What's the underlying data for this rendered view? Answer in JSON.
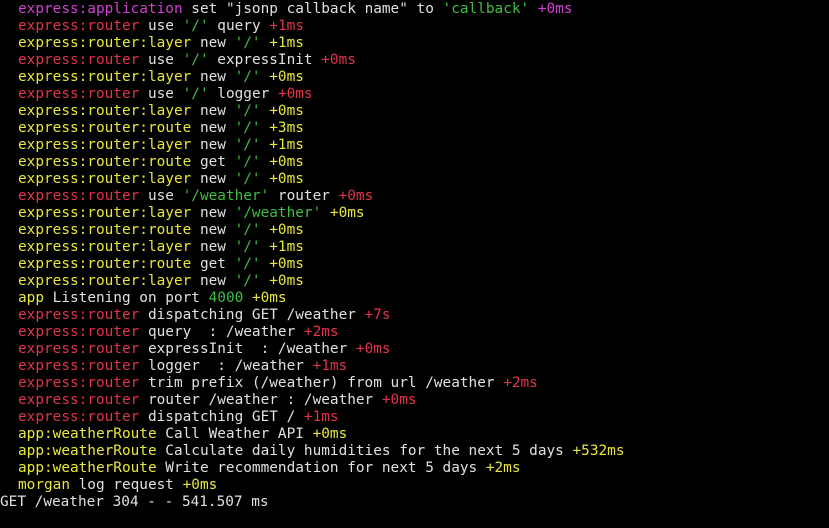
{
  "colors": {
    "magenta": "#d23fd2",
    "red": "#e0344a",
    "yellow": "#e8e83a",
    "green": "#3fbf3f",
    "white": "#e0e0e0"
  },
  "terminal": {
    "lines": [
      {
        "ns": "express:application",
        "ns_color": "#d23fd2",
        "segments": [
          {
            "t": " set \"jsonp callback name\" to ",
            "c": "#e0e0e0"
          },
          {
            "t": "'callback'",
            "c": "#3fbf3f"
          },
          {
            "t": " +0ms",
            "c": "#d23fd2"
          }
        ]
      },
      {
        "ns": "express:router",
        "ns_color": "#e0344a",
        "segments": [
          {
            "t": " use ",
            "c": "#e0e0e0"
          },
          {
            "t": "'/'",
            "c": "#3fbf3f"
          },
          {
            "t": " query ",
            "c": "#e0e0e0"
          },
          {
            "t": "+1ms",
            "c": "#e0344a"
          }
        ]
      },
      {
        "ns": "express:router:layer",
        "ns_color": "#e8e83a",
        "segments": [
          {
            "t": " new ",
            "c": "#e0e0e0"
          },
          {
            "t": "'/'",
            "c": "#3fbf3f"
          },
          {
            "t": " +1ms",
            "c": "#e8e83a"
          }
        ]
      },
      {
        "ns": "express:router",
        "ns_color": "#e0344a",
        "segments": [
          {
            "t": " use ",
            "c": "#e0e0e0"
          },
          {
            "t": "'/'",
            "c": "#3fbf3f"
          },
          {
            "t": " expressInit ",
            "c": "#e0e0e0"
          },
          {
            "t": "+0ms",
            "c": "#e0344a"
          }
        ]
      },
      {
        "ns": "express:router:layer",
        "ns_color": "#e8e83a",
        "segments": [
          {
            "t": " new ",
            "c": "#e0e0e0"
          },
          {
            "t": "'/'",
            "c": "#3fbf3f"
          },
          {
            "t": " +0ms",
            "c": "#e8e83a"
          }
        ]
      },
      {
        "ns": "express:router",
        "ns_color": "#e0344a",
        "segments": [
          {
            "t": " use ",
            "c": "#e0e0e0"
          },
          {
            "t": "'/'",
            "c": "#3fbf3f"
          },
          {
            "t": " logger ",
            "c": "#e0e0e0"
          },
          {
            "t": "+0ms",
            "c": "#e0344a"
          }
        ]
      },
      {
        "ns": "express:router:layer",
        "ns_color": "#e8e83a",
        "segments": [
          {
            "t": " new ",
            "c": "#e0e0e0"
          },
          {
            "t": "'/'",
            "c": "#3fbf3f"
          },
          {
            "t": " +0ms",
            "c": "#e8e83a"
          }
        ]
      },
      {
        "ns": "express:router:route",
        "ns_color": "#e8e83a",
        "segments": [
          {
            "t": " new ",
            "c": "#e0e0e0"
          },
          {
            "t": "'/'",
            "c": "#3fbf3f"
          },
          {
            "t": " +3ms",
            "c": "#e8e83a"
          }
        ]
      },
      {
        "ns": "express:router:layer",
        "ns_color": "#e8e83a",
        "segments": [
          {
            "t": " new ",
            "c": "#e0e0e0"
          },
          {
            "t": "'/'",
            "c": "#3fbf3f"
          },
          {
            "t": " +1ms",
            "c": "#e8e83a"
          }
        ]
      },
      {
        "ns": "express:router:route",
        "ns_color": "#e8e83a",
        "segments": [
          {
            "t": " get ",
            "c": "#e0e0e0"
          },
          {
            "t": "'/'",
            "c": "#3fbf3f"
          },
          {
            "t": " +0ms",
            "c": "#e8e83a"
          }
        ]
      },
      {
        "ns": "express:router:layer",
        "ns_color": "#e8e83a",
        "segments": [
          {
            "t": " new ",
            "c": "#e0e0e0"
          },
          {
            "t": "'/'",
            "c": "#3fbf3f"
          },
          {
            "t": " +0ms",
            "c": "#e8e83a"
          }
        ]
      },
      {
        "ns": "express:router",
        "ns_color": "#e0344a",
        "segments": [
          {
            "t": " use ",
            "c": "#e0e0e0"
          },
          {
            "t": "'/weather'",
            "c": "#3fbf3f"
          },
          {
            "t": " router ",
            "c": "#e0e0e0"
          },
          {
            "t": "+0ms",
            "c": "#e0344a"
          }
        ]
      },
      {
        "ns": "express:router:layer",
        "ns_color": "#e8e83a",
        "segments": [
          {
            "t": " new ",
            "c": "#e0e0e0"
          },
          {
            "t": "'/weather'",
            "c": "#3fbf3f"
          },
          {
            "t": " +0ms",
            "c": "#e8e83a"
          }
        ]
      },
      {
        "ns": "express:router:route",
        "ns_color": "#e8e83a",
        "segments": [
          {
            "t": " new ",
            "c": "#e0e0e0"
          },
          {
            "t": "'/'",
            "c": "#3fbf3f"
          },
          {
            "t": " +0ms",
            "c": "#e8e83a"
          }
        ]
      },
      {
        "ns": "express:router:layer",
        "ns_color": "#e8e83a",
        "segments": [
          {
            "t": " new ",
            "c": "#e0e0e0"
          },
          {
            "t": "'/'",
            "c": "#3fbf3f"
          },
          {
            "t": " +1ms",
            "c": "#e8e83a"
          }
        ]
      },
      {
        "ns": "express:router:route",
        "ns_color": "#e8e83a",
        "segments": [
          {
            "t": " get ",
            "c": "#e0e0e0"
          },
          {
            "t": "'/'",
            "c": "#3fbf3f"
          },
          {
            "t": " +0ms",
            "c": "#e8e83a"
          }
        ]
      },
      {
        "ns": "express:router:layer",
        "ns_color": "#e8e83a",
        "segments": [
          {
            "t": " new ",
            "c": "#e0e0e0"
          },
          {
            "t": "'/'",
            "c": "#3fbf3f"
          },
          {
            "t": " +0ms",
            "c": "#e8e83a"
          }
        ]
      },
      {
        "ns": "app",
        "ns_color": "#e8e83a",
        "segments": [
          {
            "t": " Listening on port ",
            "c": "#e0e0e0"
          },
          {
            "t": "4000",
            "c": "#3fbf3f"
          },
          {
            "t": " +0ms",
            "c": "#e8e83a"
          }
        ]
      },
      {
        "ns": "express:router",
        "ns_color": "#e0344a",
        "segments": [
          {
            "t": " dispatching GET /weather ",
            "c": "#e0e0e0"
          },
          {
            "t": "+7s",
            "c": "#e0344a"
          }
        ]
      },
      {
        "ns": "express:router",
        "ns_color": "#e0344a",
        "segments": [
          {
            "t": " query  : /weather ",
            "c": "#e0e0e0"
          },
          {
            "t": "+2ms",
            "c": "#e0344a"
          }
        ]
      },
      {
        "ns": "express:router",
        "ns_color": "#e0344a",
        "segments": [
          {
            "t": " expressInit  : /weather ",
            "c": "#e0e0e0"
          },
          {
            "t": "+0ms",
            "c": "#e0344a"
          }
        ]
      },
      {
        "ns": "express:router",
        "ns_color": "#e0344a",
        "segments": [
          {
            "t": " logger  : /weather ",
            "c": "#e0e0e0"
          },
          {
            "t": "+1ms",
            "c": "#e0344a"
          }
        ]
      },
      {
        "ns": "express:router",
        "ns_color": "#e0344a",
        "segments": [
          {
            "t": " trim prefix (/weather) from url /weather ",
            "c": "#e0e0e0"
          },
          {
            "t": "+2ms",
            "c": "#e0344a"
          }
        ]
      },
      {
        "ns": "express:router",
        "ns_color": "#e0344a",
        "segments": [
          {
            "t": " router /weather : /weather ",
            "c": "#e0e0e0"
          },
          {
            "t": "+0ms",
            "c": "#e0344a"
          }
        ]
      },
      {
        "ns": "express:router",
        "ns_color": "#e0344a",
        "segments": [
          {
            "t": " dispatching GET / ",
            "c": "#e0e0e0"
          },
          {
            "t": "+1ms",
            "c": "#e0344a"
          }
        ]
      },
      {
        "ns": "app:weatherRoute",
        "ns_color": "#e8e83a",
        "segments": [
          {
            "t": " Call Weather API ",
            "c": "#e0e0e0"
          },
          {
            "t": "+0ms",
            "c": "#e8e83a"
          }
        ]
      },
      {
        "ns": "app:weatherRoute",
        "ns_color": "#e8e83a",
        "segments": [
          {
            "t": " Calculate daily humidities for the next 5 days ",
            "c": "#e0e0e0"
          },
          {
            "t": "+532ms",
            "c": "#e8e83a"
          }
        ]
      },
      {
        "ns": "app:weatherRoute",
        "ns_color": "#e8e83a",
        "segments": [
          {
            "t": " Write recommendation for next 5 days ",
            "c": "#e0e0e0"
          },
          {
            "t": "+2ms",
            "c": "#e8e83a"
          }
        ]
      },
      {
        "ns": "morgan",
        "ns_color": "#e8e83a",
        "segments": [
          {
            "t": " log request ",
            "c": "#e0e0e0"
          },
          {
            "t": "+0ms",
            "c": "#e8e83a"
          }
        ]
      }
    ],
    "final_line": "GET /weather 304 - - 541.507 ms"
  }
}
